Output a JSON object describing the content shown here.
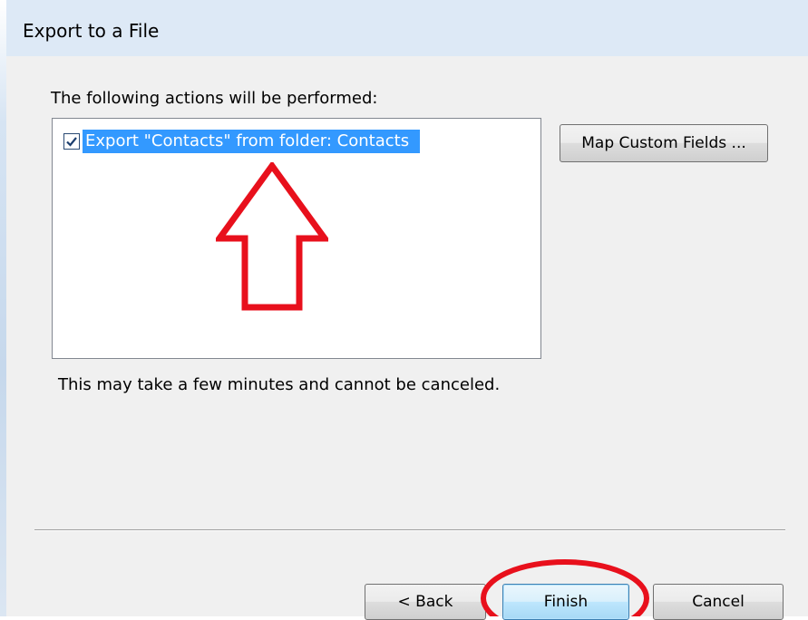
{
  "window": {
    "title": "Export to a File"
  },
  "content": {
    "instructions": "The following actions will be performed:",
    "actions": [
      {
        "label": "Export \"Contacts\" from folder: Contacts",
        "checked": true,
        "selected": true
      }
    ],
    "note": "This may take a few minutes and cannot be canceled."
  },
  "buttons": {
    "map_custom_fields": "Map Custom Fields ...",
    "back": "< Back",
    "finish": "Finish",
    "cancel": "Cancel"
  },
  "annotations": {
    "arrow_color": "#e8101c",
    "circle_color": "#e8101c"
  },
  "colors": {
    "selection": "#3399ff",
    "title_bar": "#dde9f6",
    "dialog_background": "#f0f0f0"
  }
}
